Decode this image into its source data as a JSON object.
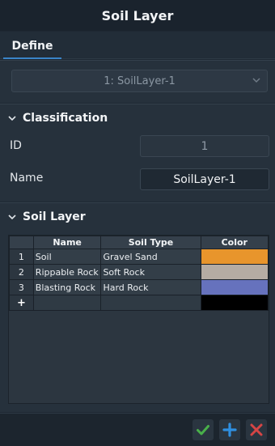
{
  "window": {
    "title": "Soil Layer"
  },
  "tabs": [
    {
      "label": "Define"
    }
  ],
  "selector": {
    "value": "1: SoilLayer-1"
  },
  "classification": {
    "header": "Classification",
    "id_label": "ID",
    "id_value": "1",
    "name_label": "Name",
    "name_value": "SoilLayer-1"
  },
  "soil_layer": {
    "header": "Soil Layer",
    "columns": [
      "",
      "Name",
      "Soil Type",
      "Color"
    ],
    "rows": [
      {
        "index": "1",
        "name": "Soil",
        "soil_type": "Gravel Sand",
        "color": "#e8952c"
      },
      {
        "index": "2",
        "name": "Rippable Rock",
        "soil_type": "Soft Rock",
        "color": "#b5aca3"
      },
      {
        "index": "3",
        "name": "Blasting Rock",
        "soil_type": "Hard Rock",
        "color": "#6672bd"
      }
    ],
    "new_row": {
      "index": "+",
      "color": "#000000"
    }
  },
  "footer": {
    "icons": [
      "check-icon",
      "plus-icon",
      "close-icon"
    ],
    "colors": {
      "ok": "#49b04a",
      "add": "#2f8fe0",
      "cancel": "#d64545"
    }
  }
}
